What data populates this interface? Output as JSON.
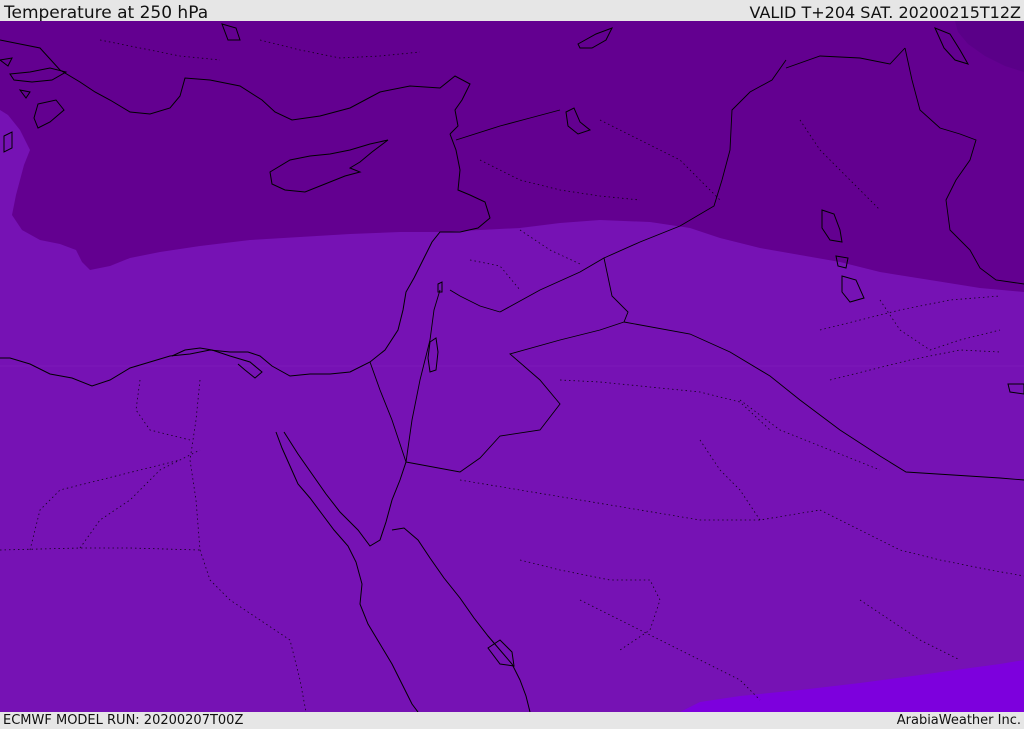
{
  "header": {
    "title": "Temperature at 250 hPa",
    "valid_time": "VALID T+204 SAT. 20200215T12Z"
  },
  "footer": {
    "model_run": "ECMWF MODEL RUN: 20200207T00Z",
    "credit": "ArabiaWeather Inc."
  },
  "map": {
    "variable": "temperature",
    "level": "250 hPa",
    "palette": {
      "cold": "#5a0088",
      "cool": "#630090",
      "mid": "#7612b4",
      "warm": "#7d00dd",
      "coast": "#000000"
    }
  }
}
